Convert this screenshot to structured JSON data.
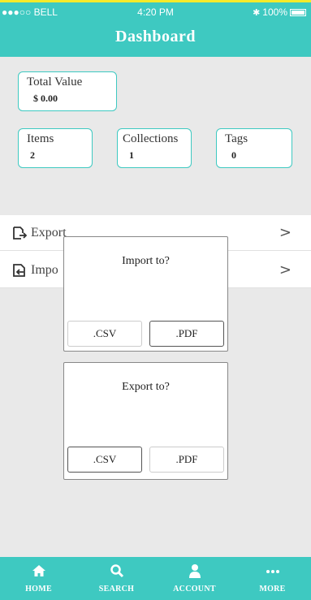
{
  "status_bar": {
    "carrier": "●●●○○ BELL",
    "time": "4:20 PM",
    "battery": "100%"
  },
  "header": {
    "title": "Dashboard"
  },
  "stats": {
    "total_value": {
      "label": "Total Value",
      "value": "$ 0.00"
    },
    "items": {
      "label": "Items",
      "value": "2"
    },
    "collections": {
      "label": "Collections",
      "value": "1"
    },
    "tags": {
      "label": "Tags",
      "value": "0"
    }
  },
  "menu": {
    "export": {
      "label": "Export",
      "chevron": ">"
    },
    "import": {
      "label": "Impo",
      "chevron": ">"
    }
  },
  "import_dialog": {
    "title": "Import to?",
    "csv": ".CSV",
    "pdf": ".PDF"
  },
  "export_dialog": {
    "title": "Export to?",
    "csv": ".CSV",
    "pdf": ".PDF"
  },
  "tabbar": {
    "tabs": [
      {
        "label": "HOME",
        "icon": "home-icon"
      },
      {
        "label": "SEARCH",
        "icon": "search-icon"
      },
      {
        "label": "ACCOUNT",
        "icon": "account-icon"
      },
      {
        "label": "MORE",
        "icon": "more-icon"
      }
    ]
  },
  "colors": {
    "accent": "#3ec9c1",
    "background": "#e9e9e9"
  }
}
